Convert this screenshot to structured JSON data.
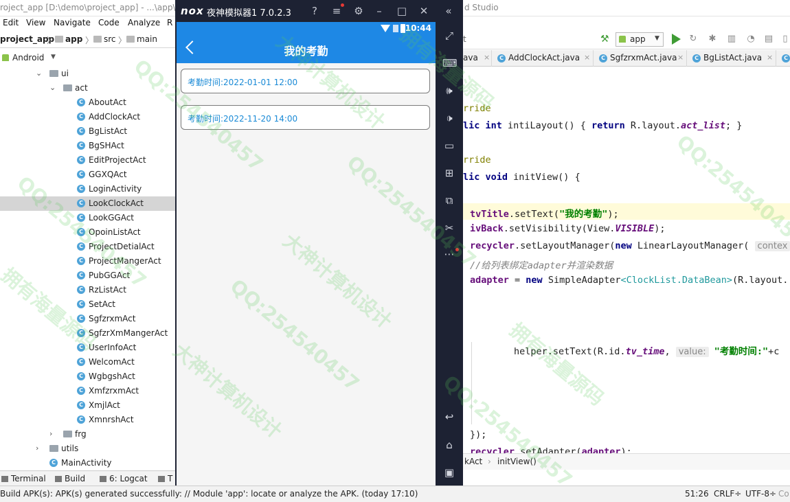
{
  "ide": {
    "title_text": "roject_app [D:\\demo\\project_app] - ...\\app\\",
    "title_suffix": "d Studio",
    "menu": [
      "Edit",
      "View",
      "Navigate",
      "Code",
      "Analyze",
      "R"
    ],
    "breadcrumb": [
      "project_app",
      "app",
      "src",
      "main"
    ],
    "project_view": "Android",
    "tree": {
      "ui": "ui",
      "act": "act",
      "files": [
        "AboutAct",
        "AddClockAct",
        "BgListAct",
        "BgSHAct",
        "EditProjectAct",
        "GGXQAct",
        "LoginActivity",
        "LookClockAct",
        "LookGGAct",
        "OpoinListAct",
        "ProjectDetialAct",
        "ProjectMangerAct",
        "PubGGAct",
        "RzListAct",
        "SetAct",
        "SgfzrxmAct",
        "SgfzrXmMangerAct",
        "UserInfoAct",
        "WelcomAct",
        "WgbgshAct",
        "XmfzrxmAct",
        "XmjlAct",
        "XmnrshAct"
      ],
      "selected": "LookClockAct",
      "frg": "frg",
      "utils": "utils",
      "main_activity": "MainActivity"
    },
    "tool_tabs": [
      "Terminal",
      "Build",
      "6: Logcat",
      "T"
    ],
    "status": {
      "message": "Build APK(s): APK(s) generated successfully: // Module 'app': locate or analyze the APK. (today 17:10)",
      "position": "51:26",
      "line_sep": "CRLF÷",
      "encoding": "UTF-8÷",
      "extra": "Co"
    },
    "toolbar": {
      "left_text": "t",
      "run_config": "app"
    },
    "editor_tabs": [
      "ava",
      "AddClockAct.java",
      "SgfzrxmAct.java",
      "BgListAct.java"
    ],
    "code": {
      "l1": "rride",
      "l2a": "lic ",
      "l2b": "int",
      "l2c": " intiLayout() { ",
      "l2d": "return",
      "l2e": " R.layout.",
      "l2f": "act_list",
      "l2g": "; }",
      "l3": "rride",
      "l4a": "lic ",
      "l4b": "void",
      "l4c": " initView() {",
      "l5a": "tvTitle",
      "l5b": ".setText(",
      "l5c": "\"我的考勤\"",
      "l5d": ");",
      "l6a": "ivBack",
      "l6b": ".setVisibility(View.",
      "l6c": "VISIBLE",
      "l6d": ");",
      "l7a": "recycler",
      "l7b": ".setLayoutManager(",
      "l7c": "new",
      "l7d": " LinearLayoutManager( ",
      "l7e": "contex",
      "l8": "//给列表绑定adapter并渲染数据",
      "l9a": "adapter",
      "l9b": " = ",
      "l9c": "new",
      "l9d": " SimpleAdapter",
      "l9e": "<ClockList.DataBean>",
      "l9f": "(R.layout.",
      "l10a": "helper.setText(R.id.",
      "l10b": "tv_time",
      "l10c": ", ",
      "l10d": "value:",
      "l10e": " \"考勤时间:\"",
      "l10f": "+c",
      "l11": "});",
      "l12a": "recycler",
      "l12b": ".setAdapter(",
      "l12c": "adapter",
      "l12d": ");"
    },
    "editor_breadcrumb": [
      "kAct",
      "initView()"
    ]
  },
  "emulator": {
    "logo": "nox",
    "title": "夜神模拟器1 7.0.2.3",
    "phone": {
      "time": "10:44",
      "page_title": "我的考勤",
      "records": [
        "考勤时间:2022-01-01 12:00",
        "考勤时间:2022-11-20 14:00"
      ]
    }
  },
  "watermarks": [
    "QQ:254540457",
    "大神计算机设计",
    "拥有海量源码",
    "QQ:254540457",
    "QQ:254540457",
    "大神计算机设计",
    "拥有海量源码",
    "QQ:254540457",
    "大神计算机设计",
    "拥有海量源码",
    "QQ:254540457",
    "QQ:254540457"
  ],
  "colors": {
    "accent": "#1e88e5",
    "record_text": "#1a8ad6",
    "emulator_bg": "#1d2233"
  }
}
